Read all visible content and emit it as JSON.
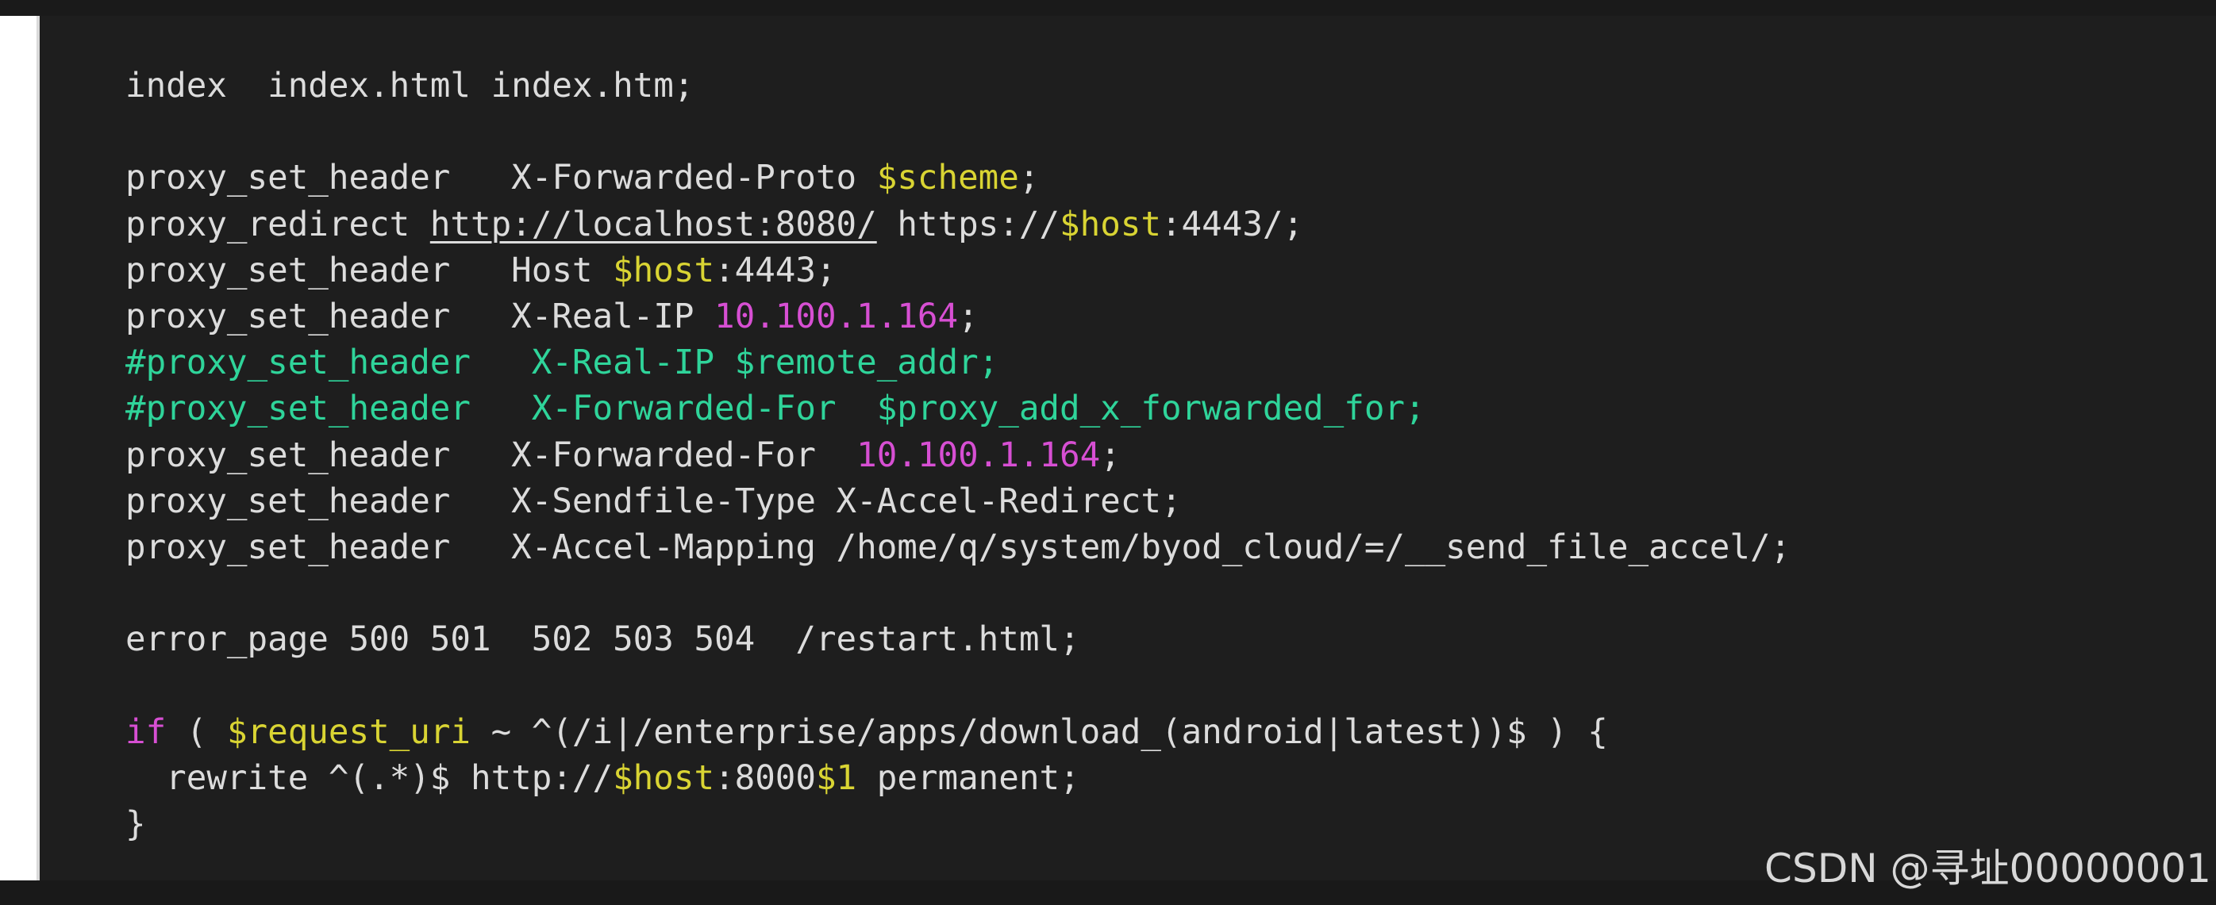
{
  "colors": {
    "background": "#1e1e1e",
    "text": "#dcdcdc",
    "variable": "#d9d433",
    "ip_number": "#d74fd3",
    "comment": "#2fd49a",
    "keyword": "#d74fd3"
  },
  "code": {
    "lines": [
      {
        "tokens": [
          {
            "text": "index  index.html index.htm;",
            "type": "plain"
          }
        ]
      },
      {
        "tokens": []
      },
      {
        "tokens": [
          {
            "text": "proxy_set_header   X-Forwarded-Proto ",
            "type": "plain"
          },
          {
            "text": "$scheme",
            "type": "var"
          },
          {
            "text": ";",
            "type": "plain"
          }
        ]
      },
      {
        "tokens": [
          {
            "text": "proxy_redirect ",
            "type": "plain"
          },
          {
            "text": "http://localhost:8080/",
            "type": "link"
          },
          {
            "text": " https://",
            "type": "plain"
          },
          {
            "text": "$host",
            "type": "var"
          },
          {
            "text": ":4443/;",
            "type": "plain"
          }
        ]
      },
      {
        "tokens": [
          {
            "text": "proxy_set_header   Host ",
            "type": "plain"
          },
          {
            "text": "$host",
            "type": "var"
          },
          {
            "text": ":4443;",
            "type": "plain"
          }
        ]
      },
      {
        "tokens": [
          {
            "text": "proxy_set_header   X-Real-IP ",
            "type": "plain"
          },
          {
            "text": "10.100.1.164",
            "type": "num"
          },
          {
            "text": ";",
            "type": "plain"
          }
        ]
      },
      {
        "tokens": [
          {
            "text": "#proxy_set_header   X-Real-IP $remote_addr;",
            "type": "comment"
          }
        ]
      },
      {
        "tokens": [
          {
            "text": "#proxy_set_header   X-Forwarded-For  $proxy_add_x_forwarded_for;",
            "type": "comment"
          }
        ]
      },
      {
        "tokens": [
          {
            "text": "proxy_set_header   X-Forwarded-For  ",
            "type": "plain"
          },
          {
            "text": "10.100.1.164",
            "type": "num"
          },
          {
            "text": ";",
            "type": "plain"
          }
        ]
      },
      {
        "tokens": [
          {
            "text": "proxy_set_header   X-Sendfile-Type X-Accel-Redirect;",
            "type": "plain"
          }
        ]
      },
      {
        "tokens": [
          {
            "text": "proxy_set_header   X-Accel-Mapping /home/q/system/byod_cloud/=/__send_file_accel/;",
            "type": "plain"
          }
        ]
      },
      {
        "tokens": []
      },
      {
        "tokens": [
          {
            "text": "error_page 500 501  502 503 504  /restart.html;",
            "type": "plain"
          }
        ]
      },
      {
        "tokens": []
      },
      {
        "tokens": [
          {
            "text": "if",
            "type": "kw"
          },
          {
            "text": " ( ",
            "type": "plain"
          },
          {
            "text": "$request_uri",
            "type": "var"
          },
          {
            "text": " ~ ^(/i|/enterprise/apps/download_(android|latest))$ ) {",
            "type": "plain"
          }
        ]
      },
      {
        "tokens": [
          {
            "text": "  rewrite ^(.*)$ http://",
            "type": "plain"
          },
          {
            "text": "$host",
            "type": "var"
          },
          {
            "text": ":8000",
            "type": "plain"
          },
          {
            "text": "$1",
            "type": "var"
          },
          {
            "text": " permanent;",
            "type": "plain"
          }
        ]
      },
      {
        "tokens": [
          {
            "text": "}",
            "type": "plain"
          }
        ]
      }
    ]
  },
  "watermark": {
    "text": "CSDN @寻址00000001"
  }
}
